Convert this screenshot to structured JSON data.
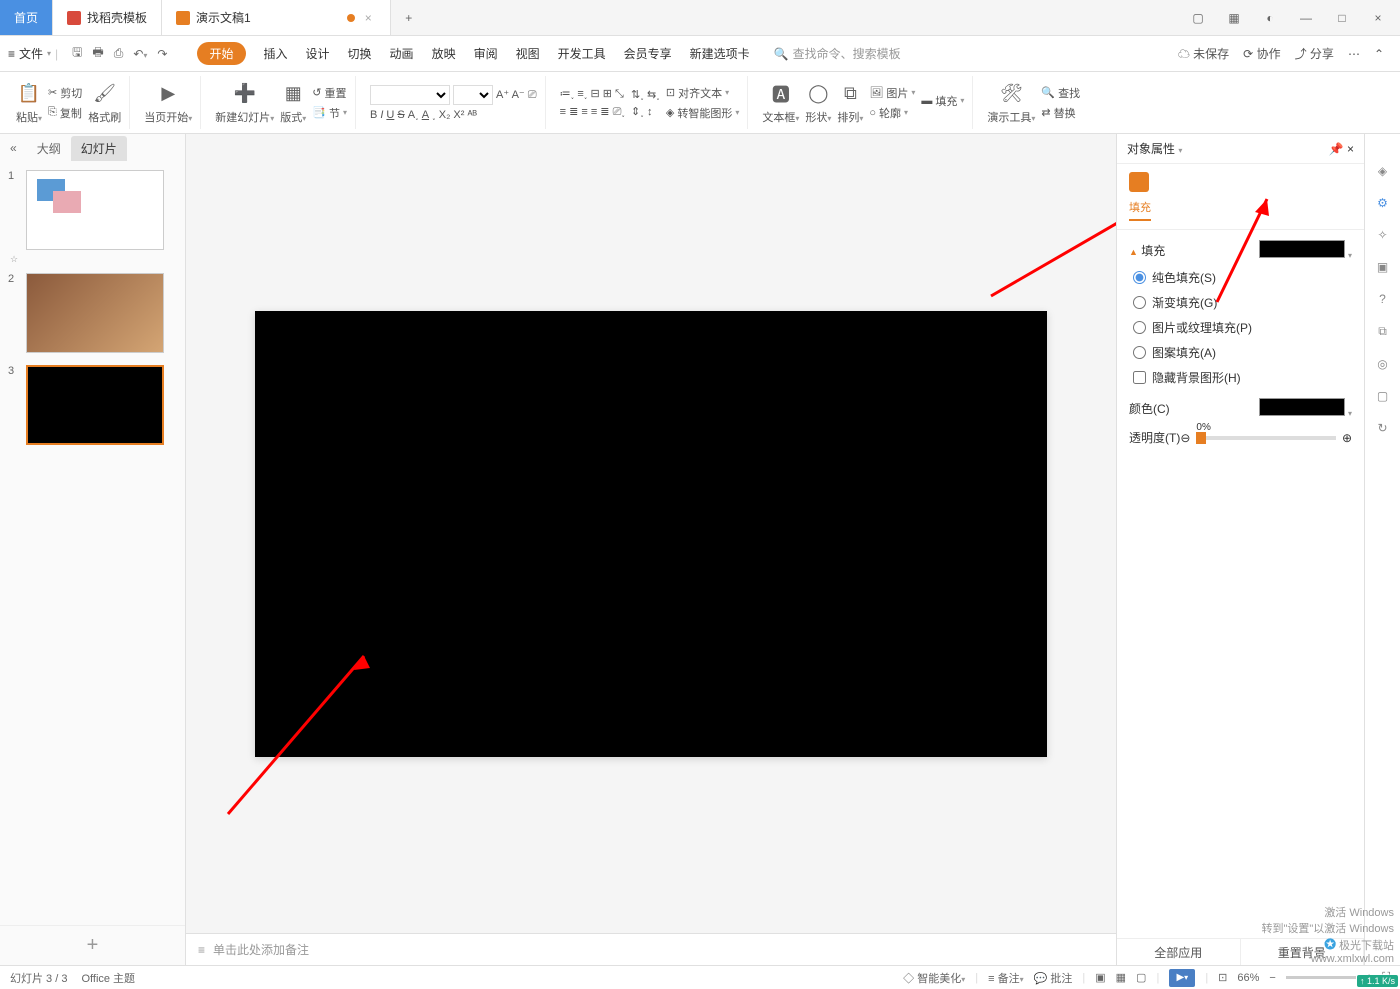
{
  "titlebar": {
    "tabs": [
      {
        "label": "首页"
      },
      {
        "label": "找稻壳模板"
      },
      {
        "label": "演示文稿1"
      }
    ]
  },
  "menubar": {
    "file_label": "文件",
    "tabs": [
      "开始",
      "插入",
      "设计",
      "切换",
      "动画",
      "放映",
      "审阅",
      "视图",
      "开发工具",
      "会员专享",
      "新建选项卡"
    ],
    "search_placeholder": "查找命令、搜索模板",
    "right": {
      "unsaved": "未保存",
      "collab": "协作",
      "share": "分享"
    }
  },
  "ribbon": {
    "paste": "粘贴",
    "cut": "剪切",
    "copy": "复制",
    "format_painter": "格式刷",
    "start_current": "当页开始",
    "new_slide": "新建幻灯片",
    "layout": "版式",
    "reset": "重置",
    "section": "节",
    "align_text": "对齐文本",
    "smart_shape": "转智能图形",
    "textbox": "文本框",
    "shapes": "形状",
    "arrange": "排列",
    "picture": "图片",
    "fill": "填充",
    "outline": "轮廓",
    "tools": "演示工具",
    "find": "查找",
    "replace": "替换"
  },
  "left_panel": {
    "views": [
      "大纲",
      "幻灯片"
    ],
    "slides": [
      "1",
      "2",
      "3"
    ]
  },
  "notes_placeholder": "单击此处添加备注",
  "right_panel": {
    "title": "对象属性",
    "tab_label": "填充",
    "section_fill": "填充",
    "radios": {
      "solid": "纯色填充(S)",
      "gradient": "渐变填充(G)",
      "picture": "图片或纹理填充(P)",
      "pattern": "图案填充(A)"
    },
    "hide_bg": "隐藏背景图形(H)",
    "color_label": "颜色(C)",
    "transparency_label": "透明度(T)",
    "transparency_value": "0%",
    "footer": {
      "apply_all": "全部应用",
      "reset_bg": "重置背景"
    }
  },
  "statusbar": {
    "slide_index": "幻灯片 3 / 3",
    "theme": "Office 主题",
    "beautify": "智能美化",
    "notes": "备注",
    "comments": "批注",
    "zoom": "66%"
  },
  "watermark": {
    "activate": "激活 Windows",
    "goto": "转到\"设置\"以激活 Windows",
    "site1": "极光下载站",
    "site2": "www.xmlxwl.com",
    "net": "1.1 K/s"
  }
}
